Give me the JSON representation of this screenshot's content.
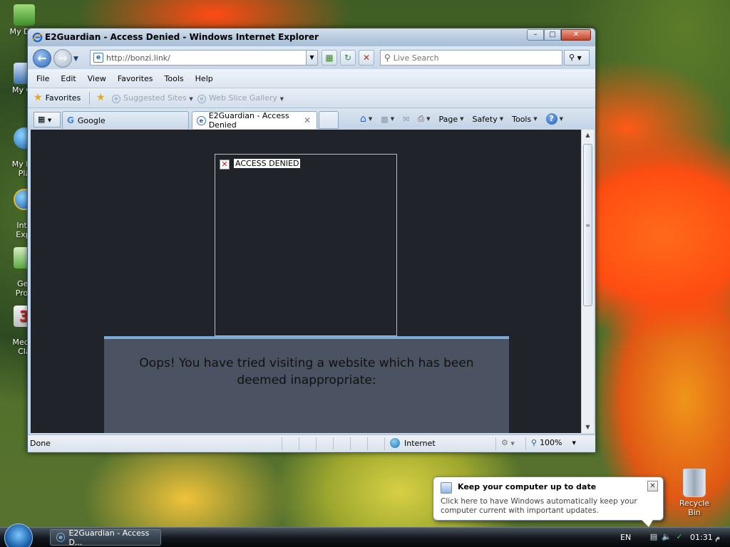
{
  "desktop": {
    "icons": [
      {
        "label": "My Doc"
      },
      {
        "label": "My Co"
      },
      {
        "label": "My Ne\nPla"
      },
      {
        "label": "Inte\nExpl"
      },
      {
        "label": "Ger\nProg"
      },
      {
        "label": "Media\nCla"
      }
    ],
    "recycle_bin": "Recycle Bin"
  },
  "window": {
    "title": "E2Guardian - Access Denied - Windows Internet Explorer",
    "address": "http://bonzi.link/",
    "search_placeholder": "Live Search",
    "menu": [
      "File",
      "Edit",
      "View",
      "Favorites",
      "Tools",
      "Help"
    ],
    "favorites": {
      "label": "Favorites",
      "items": [
        "Suggested Sites",
        "Web Slice Gallery"
      ]
    },
    "tabs": [
      {
        "label": "Google"
      },
      {
        "label": "E2Guardian - Access Denied"
      }
    ],
    "command_bar": [
      "Page",
      "Safety",
      "Tools"
    ],
    "page": {
      "image_alt": "ACCESS DENIED",
      "message": "Oops! You have tried visiting a website which has been deemed inappropriate:"
    },
    "status": {
      "text": "Done",
      "zone": "Internet",
      "zoom": "100%"
    }
  },
  "notification": {
    "title": "Keep your computer up to date",
    "text": "Click here to have Windows automatically keep your computer current with important updates."
  },
  "taskbar": {
    "task_label": "E2Guardian - Access D...",
    "language": "EN",
    "clock": "01:31 م"
  },
  "colors": {
    "page_background": "#20232a",
    "panel_background": "#4b5262",
    "panel_accent": "#7fa9d9"
  }
}
